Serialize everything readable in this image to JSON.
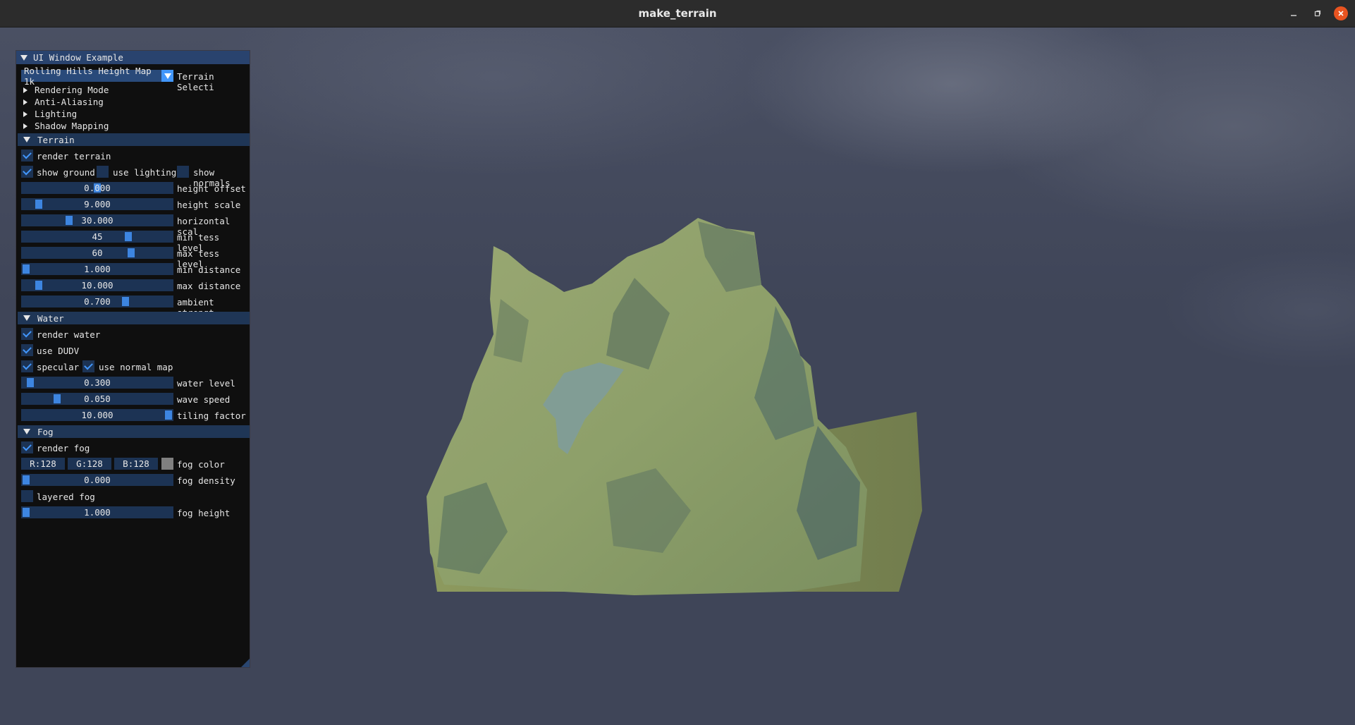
{
  "window": {
    "title": "make_terrain"
  },
  "colors": {
    "fog_swatch": "#808080",
    "accent": "#4296fa",
    "panel_bg": "#0f0f0f"
  },
  "panel": {
    "title": "UI Window Example",
    "terrain_combo": {
      "value": "Rolling Hills Height Map 1k",
      "label": "Terrain Selecti"
    },
    "tree_nodes": [
      "Rendering Mode",
      "Anti-Aliasing",
      "Lighting",
      "Shadow Mapping"
    ],
    "terrain": {
      "header": "Terrain",
      "render_terrain": {
        "label": "render terrain",
        "checked": true
      },
      "show_ground": {
        "label": "show ground",
        "checked": true
      },
      "use_lighting": {
        "label": "use lighting",
        "checked": false
      },
      "show_normals": {
        "label": "show normals",
        "checked": false
      },
      "sliders": [
        {
          "value": "0.000",
          "label": "height offset",
          "level": 0.5
        },
        {
          "value": "9.000",
          "label": "height scale",
          "level": 0.09
        },
        {
          "value": "30.000",
          "label": "horizontal scal",
          "level": 0.3
        },
        {
          "value": "45",
          "label": "min tess level",
          "level": 0.72
        },
        {
          "value": "60",
          "label": "max tess level",
          "level": 0.74
        },
        {
          "value": "1.000",
          "label": "min distance",
          "level": 0.0
        },
        {
          "value": "10.000",
          "label": "max distance",
          "level": 0.09
        },
        {
          "value": "0.700",
          "label": "ambient strengt",
          "level": 0.7
        }
      ]
    },
    "water": {
      "header": "Water",
      "render_water": {
        "label": "render water",
        "checked": true
      },
      "use_dudv": {
        "label": "use DUDV",
        "checked": true
      },
      "specular": {
        "label": "specular",
        "checked": true
      },
      "use_normal_map": {
        "label": "use normal map",
        "checked": true
      },
      "sliders": [
        {
          "value": "0.300",
          "label": "water level",
          "level": 0.03
        },
        {
          "value": "0.050",
          "label": "wave speed",
          "level": 0.22
        },
        {
          "value": "10.000",
          "label": "tiling factor",
          "level": 1.0
        }
      ]
    },
    "fog": {
      "header": "Fog",
      "render_fog": {
        "label": "render fog",
        "checked": true
      },
      "color": {
        "r": "R:128",
        "g": "G:128",
        "b": "B:128",
        "label": "fog color"
      },
      "density": {
        "value": "0.000",
        "label": "fog density",
        "level": 0.0
      },
      "layered_fog": {
        "label": "layered fog",
        "checked": false
      },
      "height": {
        "value": "1.000",
        "label": "fog height",
        "level": 0.0
      }
    }
  }
}
